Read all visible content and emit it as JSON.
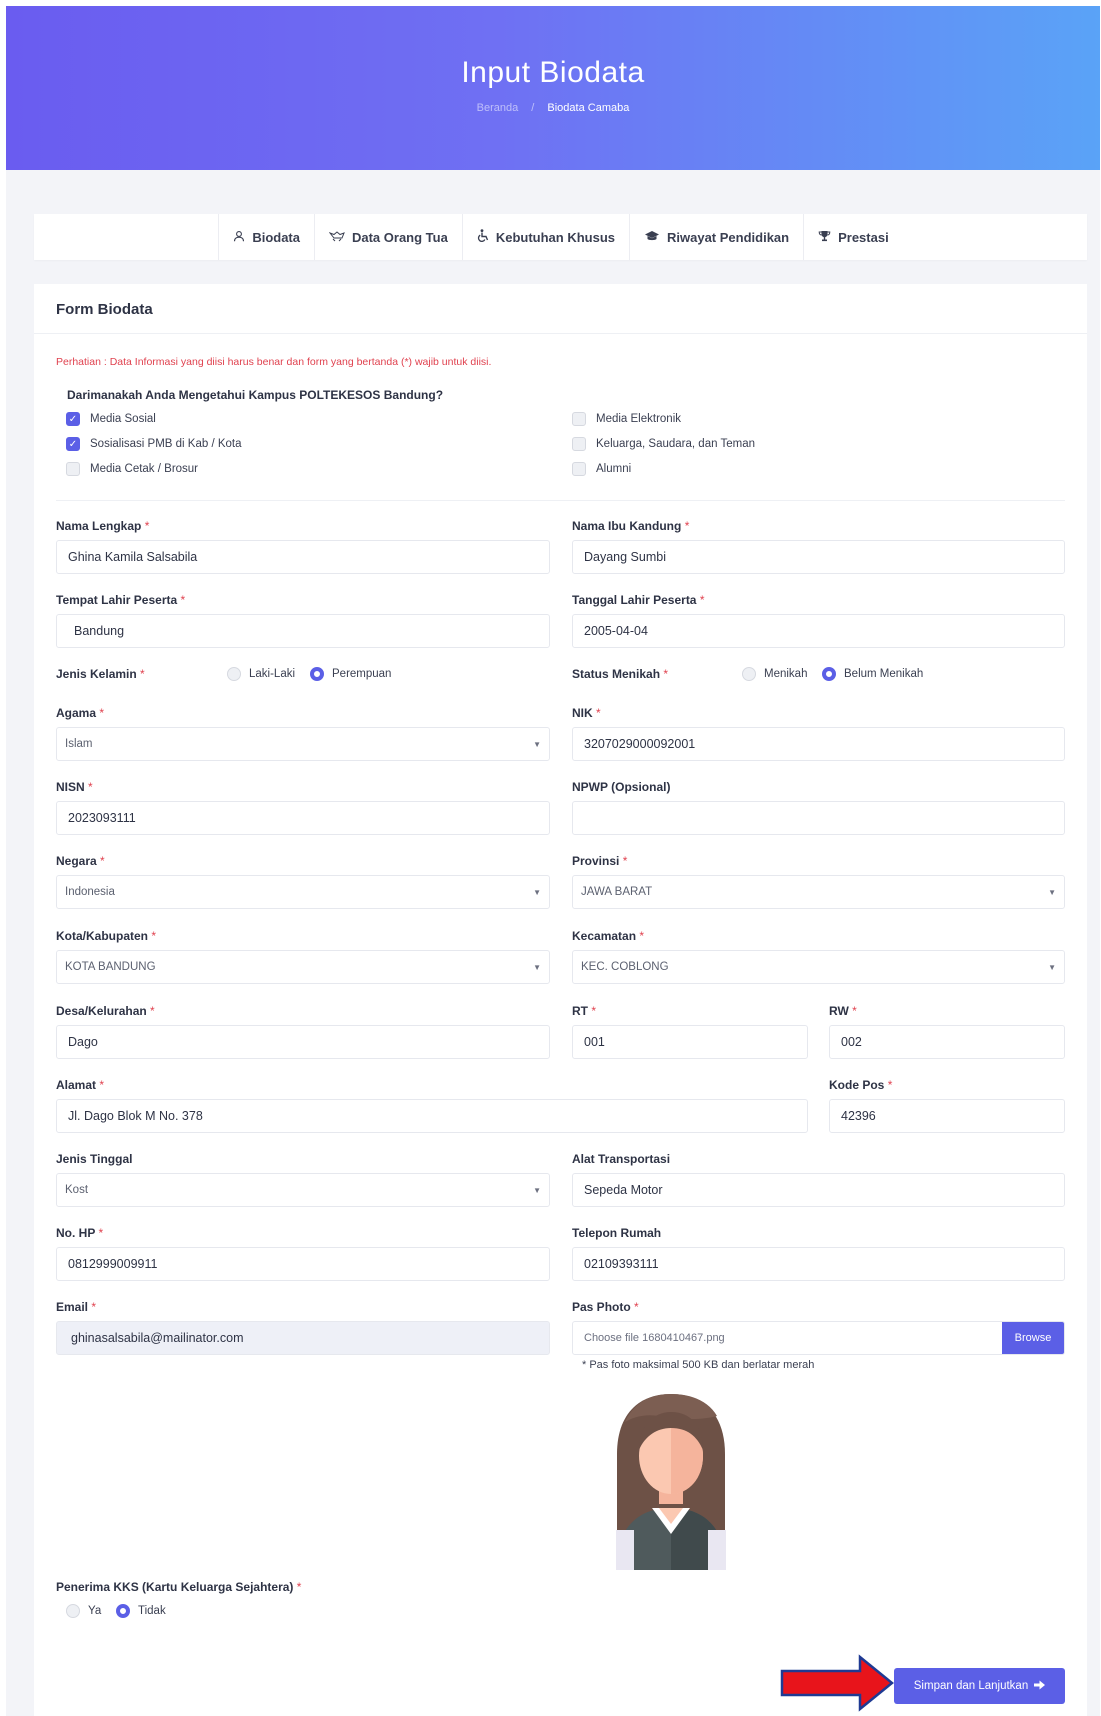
{
  "header": {
    "title": "Input Biodata",
    "breadcrumb_home": "Beranda",
    "breadcrumb_sep": "/",
    "breadcrumb_current": "Biodata Camaba"
  },
  "tabs": [
    {
      "label": "Biodata",
      "icon": "user-icon"
    },
    {
      "label": "Data Orang Tua",
      "icon": "parents-icon"
    },
    {
      "label": "Kebutuhan Khusus",
      "icon": "wheelchair-icon"
    },
    {
      "label": "Riwayat Pendidikan",
      "icon": "graduation-cap-icon"
    },
    {
      "label": "Prestasi",
      "icon": "trophy-icon"
    }
  ],
  "form": {
    "title": "Form Biodata",
    "warning": "Perhatian : Data Informasi yang diisi harus benar dan form yang bertanda (*) wajib untuk diisi.",
    "source_question": "Darimanakah Anda Mengetahui Kampus POLTEKESOS Bandung?",
    "sources": [
      {
        "label": "Media Sosial",
        "checked": true
      },
      {
        "label": "Sosialisasi PMB di Kab / Kota",
        "checked": true
      },
      {
        "label": "Media Cetak / Brosur",
        "checked": false
      },
      {
        "label": "Media Elektronik",
        "checked": false
      },
      {
        "label": "Keluarga, Saudara, dan Teman",
        "checked": false
      },
      {
        "label": "Alumni",
        "checked": false
      }
    ],
    "req_mark": "*",
    "fields": {
      "nama_lengkap": {
        "label": "Nama Lengkap",
        "value": "Ghina Kamila Salsabila"
      },
      "nama_ibu": {
        "label": "Nama Ibu Kandung",
        "value": "Dayang Sumbi"
      },
      "tempat_lahir": {
        "label": "Tempat Lahir Peserta",
        "value": "Bandung"
      },
      "tanggal_lahir": {
        "label": "Tanggal Lahir Peserta",
        "value": "2005-04-04"
      },
      "jenis_kelamin": {
        "label": "Jenis Kelamin",
        "options": [
          "Laki-Laki",
          "Perempuan"
        ],
        "selected": "Perempuan"
      },
      "status_menikah": {
        "label": "Status Menikah",
        "options": [
          "Menikah",
          "Belum Menikah"
        ],
        "selected": "Belum Menikah"
      },
      "agama": {
        "label": "Agama",
        "value": "Islam"
      },
      "nik": {
        "label": "NIK",
        "value": "3207029000092001"
      },
      "nisn": {
        "label": "NISN",
        "value": "2023093111"
      },
      "npwp": {
        "label": "NPWP (Opsional)",
        "value": ""
      },
      "negara": {
        "label": "Negara",
        "value": "Indonesia"
      },
      "provinsi": {
        "label": "Provinsi",
        "value": "JAWA BARAT"
      },
      "kota": {
        "label": "Kota/Kabupaten",
        "value": "KOTA BANDUNG"
      },
      "kecamatan": {
        "label": "Kecamatan",
        "value": "KEC. COBLONG"
      },
      "desa": {
        "label": "Desa/Kelurahan",
        "value": "Dago"
      },
      "rt": {
        "label": "RT",
        "value": "001"
      },
      "rw": {
        "label": "RW",
        "value": "002"
      },
      "alamat": {
        "label": "Alamat",
        "value": "Jl. Dago Blok M No. 378"
      },
      "kode_pos": {
        "label": "Kode Pos",
        "value": "42396"
      },
      "jenis_tinggal": {
        "label": "Jenis Tinggal",
        "value": "Kost"
      },
      "alat_transportasi": {
        "label": "Alat Transportasi",
        "value": "Sepeda Motor"
      },
      "no_hp": {
        "label": "No. HP",
        "value": "0812999009911"
      },
      "telepon_rumah": {
        "label": "Telepon Rumah",
        "value": "02109393111"
      },
      "email": {
        "label": "Email",
        "value": "ghinasalsabila@mailinator.com"
      },
      "pas_photo": {
        "label": "Pas Photo",
        "file_text": "Choose file 1680410467.png",
        "browse": "Browse",
        "note": "* Pas foto maksimal 500 KB dan berlatar merah"
      },
      "kks": {
        "label": "Penerima KKS (Kartu Keluarga Sejahtera)",
        "options": [
          "Ya",
          "Tidak"
        ],
        "selected": "Tidak"
      }
    },
    "submit_label": "Simpan dan Lanjutkan"
  },
  "colors": {
    "primary": "#5b5fe6",
    "header_gradient_start": "#6a5cf0",
    "header_gradient_end": "#5aa3f7",
    "required": "#e0424f",
    "annotation_arrow": "#e8141b"
  }
}
